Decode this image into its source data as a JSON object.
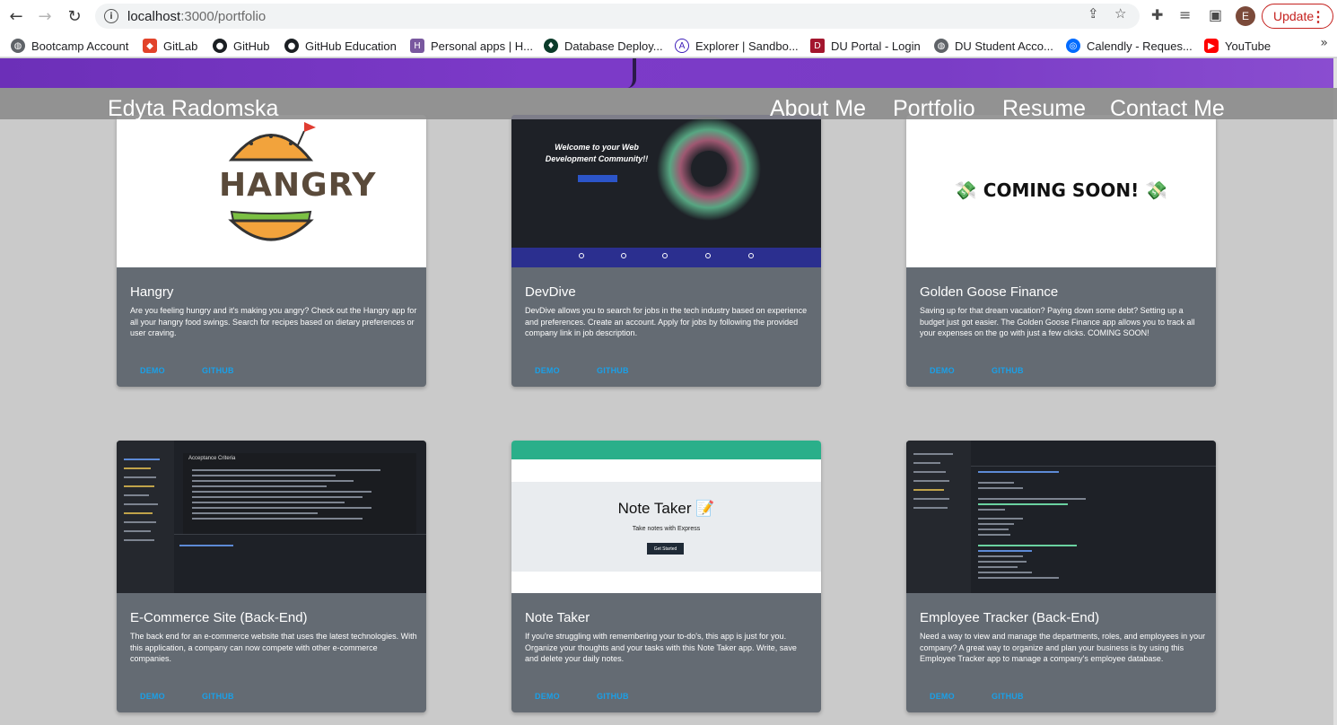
{
  "browser": {
    "url_host": "localhost",
    "url_rest": ":3000/portfolio",
    "update_label": "Update",
    "avatar_letter": "E"
  },
  "bookmarks": [
    {
      "label": "Bootcamp Account",
      "icon": "globe-icon"
    },
    {
      "label": "GitLab",
      "icon": "gitlab-icon"
    },
    {
      "label": "GitHub",
      "icon": "github-icon"
    },
    {
      "label": "GitHub Education",
      "icon": "github-icon"
    },
    {
      "label": "Personal apps | H...",
      "icon": "heroku-icon"
    },
    {
      "label": "Database Deploy...",
      "icon": "mongodb-icon"
    },
    {
      "label": "Explorer | Sandbo...",
      "icon": "apollo-icon"
    },
    {
      "label": "DU Portal - Login",
      "icon": "du-icon"
    },
    {
      "label": "DU Student Acco...",
      "icon": "globe-icon"
    },
    {
      "label": "Calendly - Reques...",
      "icon": "calendly-icon"
    },
    {
      "label": "YouTube",
      "icon": "youtube-icon"
    }
  ],
  "site": {
    "name": "Edyta Radomska",
    "nav": [
      "About Me",
      "Portfolio",
      "Resume",
      "Contact Me"
    ]
  },
  "projects": [
    {
      "title": "Hangry",
      "description": "Are you feeling hungry and it's making you angry? Check out the Hangry app for all your hangry food swings. Search for recipes based on dietary preferences or user craving.",
      "demo": "DEMO",
      "github": "GITHUB",
      "image_text": "HANGRY"
    },
    {
      "title": "DevDive",
      "description": "DevDive allows you to search for jobs in the tech industry based on experience and preferences. Create an account. Apply for jobs by following the provided company link in job description.",
      "demo": "DEMO",
      "github": "GITHUB",
      "image_text": "Welcome to your Web Development Community!!"
    },
    {
      "title": "Golden Goose Finance",
      "description": "Saving up for that dream vacation? Paying down some debt? Setting up a budget just got easier. The Golden Goose Finance app allows you to track all your expenses on the go with just a few clicks. COMING SOON!",
      "demo": "DEMO",
      "github": "GITHUB",
      "image_text": "COMING SOON!"
    },
    {
      "title": "E-Commerce Site (Back-End)",
      "description": "The back end for an e-commerce website that uses the latest technologies. With this application, a company can now compete with other e-commerce companies.",
      "demo": "DEMO",
      "github": "GITHUB",
      "image_text": "Acceptance Criteria"
    },
    {
      "title": "Note Taker",
      "description": "If you're struggling with remembering your to-do's, this app is just for you. Organize your thoughts and your tasks with this Note Taker app. Write, save and delete your daily notes.",
      "demo": "DEMO",
      "github": "GITHUB",
      "image_title": "Note Taker 📝",
      "image_sub": "Take notes with Express",
      "image_btn": "Get Started"
    },
    {
      "title": "Employee Tracker (Back-End)",
      "description": "Need a way to view and manage the departments, roles, and employees in your company? A great way to organize and plan your business is by using this Employee Tracker app to manage a company's employee database.",
      "demo": "DEMO",
      "github": "GITHUB"
    }
  ]
}
